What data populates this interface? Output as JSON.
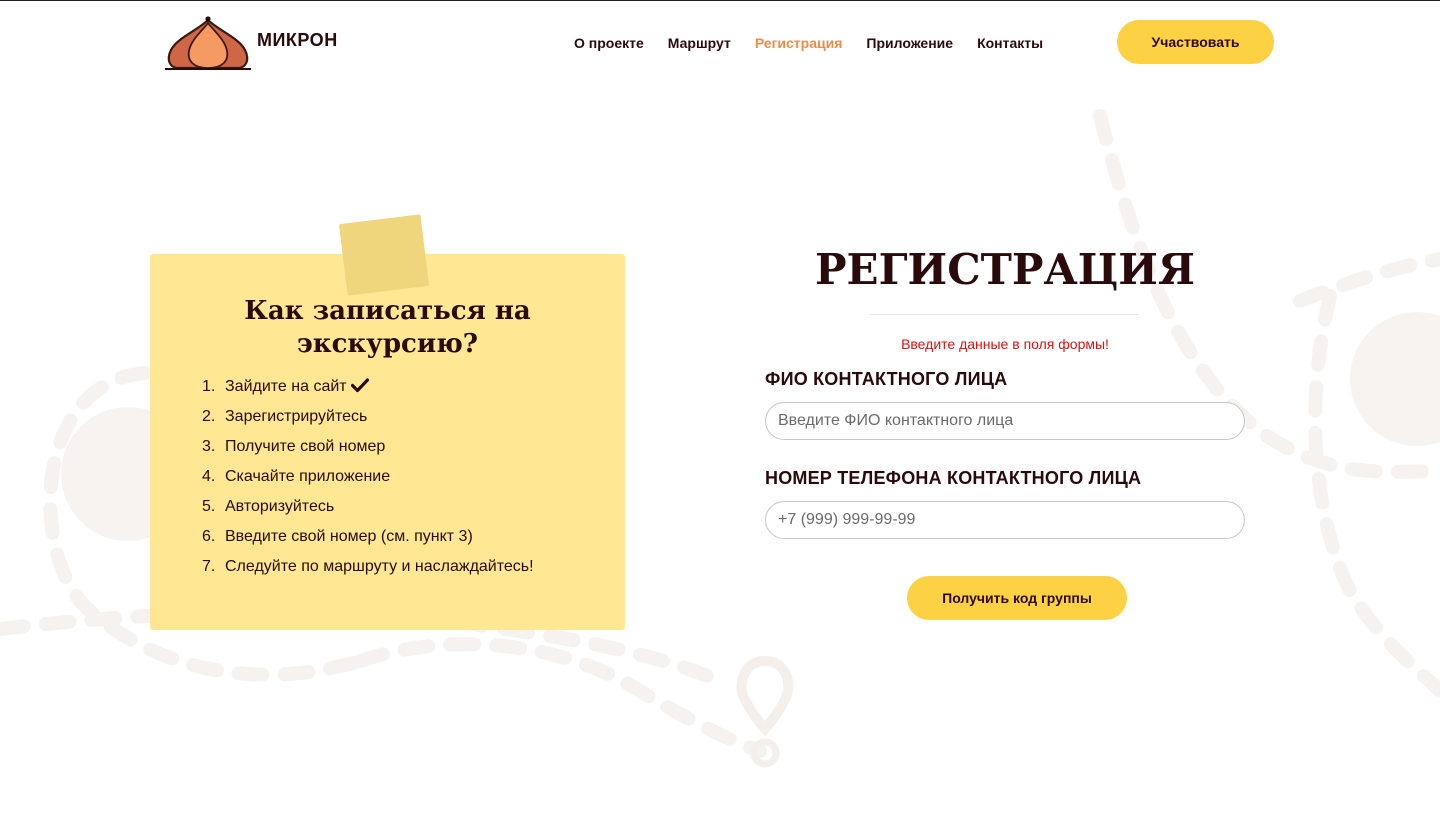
{
  "brand": {
    "name": "МИКРОН",
    "logo_icon": "onion-dome-icon"
  },
  "nav": {
    "items": [
      {
        "label": "О проекте"
      },
      {
        "label": "Маршрут"
      },
      {
        "label": "Регистрация"
      },
      {
        "label": "Приложение"
      },
      {
        "label": "Контакты"
      }
    ],
    "active_item": "Регистрация",
    "cta_label": "Участвовать"
  },
  "instructions": {
    "title": "Как записаться на экскурсию?",
    "steps": [
      {
        "num": "1.",
        "text": "Зайдите на сайт",
        "icon": "check-icon"
      },
      {
        "num": "2.",
        "text": "Зарегистрируйтесь"
      },
      {
        "num": "3.",
        "text": "Получите свой номер"
      },
      {
        "num": "4.",
        "text": "Скачайте приложение"
      },
      {
        "num": "5.",
        "text": "Авторизуйтесь"
      },
      {
        "num": "6.",
        "text": "Введите свой номер (см. пункт 3)"
      },
      {
        "num": "7.",
        "text": "Следуйте по маршруту и наслаждайтесь!"
      }
    ]
  },
  "form": {
    "title": "РЕГИСТРАЦИЯ",
    "hint": "Введите данные в поля формы!",
    "name_label": "ФИО КОНТАКТНОГО ЛИЦА",
    "name_placeholder": "Введите ФИО контактного лица",
    "name_value": "",
    "phone_label": "НОМЕР ТЕЛЕФОНА КОНТАКТНОГО ЛИЦА",
    "phone_placeholder": "+7 (999) 999-99-99",
    "phone_value": "",
    "submit_label": "Получить код группы"
  },
  "colors": {
    "accent": "#fdd144",
    "nav_active": "#f08c4a",
    "note_background": "#ffe794",
    "hint_text": "#e01010",
    "text_dark": "#2a0a0a",
    "decor": "#f7f3f0"
  }
}
